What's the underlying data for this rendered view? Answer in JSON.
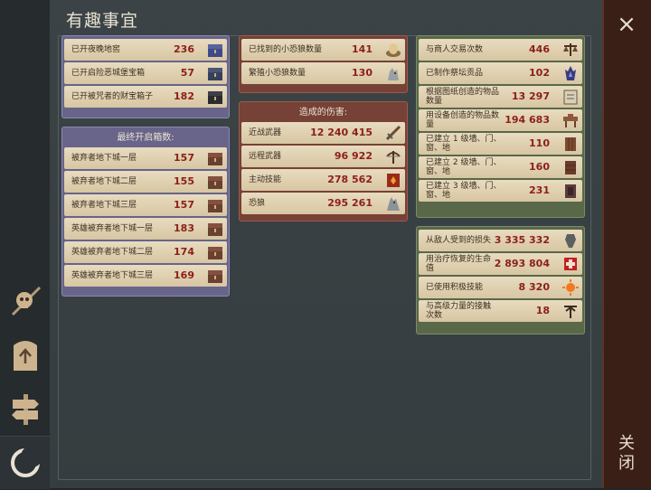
{
  "title": "有趣事宜",
  "close_label": "关闭",
  "close_icon": "×",
  "colors": {
    "value": "#8c1f1a",
    "label": "#3b2f22",
    "row_bg": "#e0d1b1",
    "purple": "#68648a",
    "red": "#764137",
    "green": "#596849"
  },
  "chests": {
    "rows": [
      {
        "label": "已开夜晚地窖",
        "value": "236",
        "icon": "night-chest-icon"
      },
      {
        "label": "已开启险恶城堡宝箱",
        "value": "57",
        "icon": "castle-chest-icon"
      },
      {
        "label": "已开被咒者的财宝箱子",
        "value": "182",
        "icon": "cursed-chest-icon"
      }
    ]
  },
  "final_chests": {
    "header": "最终开启箱数:",
    "rows": [
      {
        "label": "被弃者地下城一层",
        "value": "157",
        "icon": "chest-icon"
      },
      {
        "label": "被弃者地下城二层",
        "value": "155",
        "icon": "chest-icon"
      },
      {
        "label": "被弃者地下城三层",
        "value": "157",
        "icon": "chest-icon"
      },
      {
        "label": "英雄被弃者地下城一层",
        "value": "183",
        "icon": "chest-icon"
      },
      {
        "label": "英雄被弃者地下城二层",
        "value": "174",
        "icon": "chest-icon"
      },
      {
        "label": "英雄被弃者地下城三层",
        "value": "169",
        "icon": "chest-icon"
      }
    ]
  },
  "dino": {
    "rows": [
      {
        "label": "已找到的小恐狼数量",
        "value": "141",
        "icon": "egg-nest-icon"
      },
      {
        "label": "繁殖小恐狼数量",
        "value": "130",
        "icon": "wolf-pup-icon"
      }
    ]
  },
  "damage": {
    "header": "造成的伤害:",
    "rows": [
      {
        "label": "近战武器",
        "value": "12 240 415",
        "icon": "melee-weapon-icon"
      },
      {
        "label": "远程武器",
        "value": "96 922",
        "icon": "crossbow-icon"
      },
      {
        "label": "主动技能",
        "value": "278 562",
        "icon": "skill-book-icon"
      },
      {
        "label": "恐狼",
        "value": "295 261",
        "icon": "wolf-icon"
      }
    ]
  },
  "crafting": {
    "rows": [
      {
        "label": "与商人交易次数",
        "value": "446",
        "icon": "scales-icon"
      },
      {
        "label": "已制作祭坛贡品",
        "value": "102",
        "icon": "altar-icon"
      },
      {
        "label": "根据图纸创造的物品数量",
        "value": "13 297",
        "icon": "blueprint-icon"
      },
      {
        "label": "用设备创造的物品数量",
        "value": "194 683",
        "icon": "workbench-icon"
      },
      {
        "label": "已建立 1 级墙、门、窗、地",
        "value": "110",
        "icon": "wall-1-icon"
      },
      {
        "label": "已建立 2 级墙、门、窗、地",
        "value": "160",
        "icon": "wall-2-icon"
      },
      {
        "label": "已建立 3 级墙、门、窗、地",
        "value": "231",
        "icon": "wall-3-icon"
      }
    ]
  },
  "combat": {
    "rows": [
      {
        "label": "从敌人受到的损失",
        "value": "3 335 332",
        "icon": "damage-taken-icon"
      },
      {
        "label": "用治疗恢复的生命值",
        "value": "2 893 804",
        "icon": "heal-cross-icon"
      },
      {
        "label": "已使用积极技能",
        "value": "8 320",
        "icon": "sun-skill-icon"
      },
      {
        "label": "与高级力量的接触次数",
        "value": "18",
        "icon": "totem-icon"
      }
    ]
  },
  "sidebar": [
    "skull-spear-icon",
    "totem-stone-icon",
    "signpost-icon",
    "crescent-moon-icon"
  ]
}
